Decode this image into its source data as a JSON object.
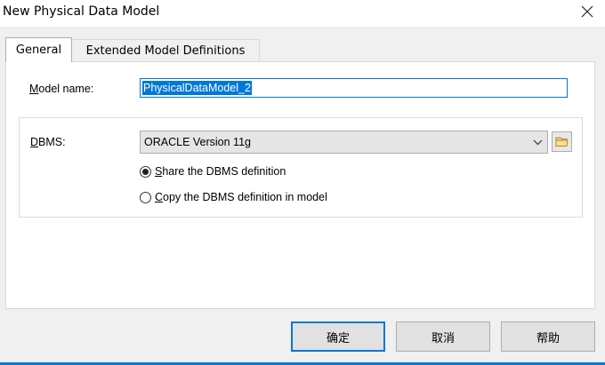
{
  "window": {
    "title": "New Physical Data Model",
    "close_icon": "close-icon"
  },
  "tabs": [
    {
      "label": "General",
      "active": true
    },
    {
      "label": "Extended Model Definitions",
      "active": false
    }
  ],
  "general": {
    "model_name_label": "Model name:",
    "model_name_label_mnemonic": "M",
    "model_name_label_rest": "odel name:",
    "model_name_value": "PhysicalDataModel_2",
    "dbms_label_mnemonic": "D",
    "dbms_label_rest": "BMS:",
    "dbms_label": "DBMS:",
    "dbms_selected": "ORACLE Version 11g",
    "radio_share_mnemonic": "S",
    "radio_share_rest": "hare the DBMS definition",
    "radio_share": "Share the DBMS definition",
    "radio_copy_mnemonic": "C",
    "radio_copy_rest": "opy the DBMS definition in model",
    "radio_copy": "Copy the DBMS definition in model",
    "selected_option": "share"
  },
  "buttons": {
    "ok": "确定",
    "cancel": "取消",
    "help": "帮助"
  },
  "colors": {
    "accent": "#0078d7",
    "background": "#f0f0f0"
  }
}
